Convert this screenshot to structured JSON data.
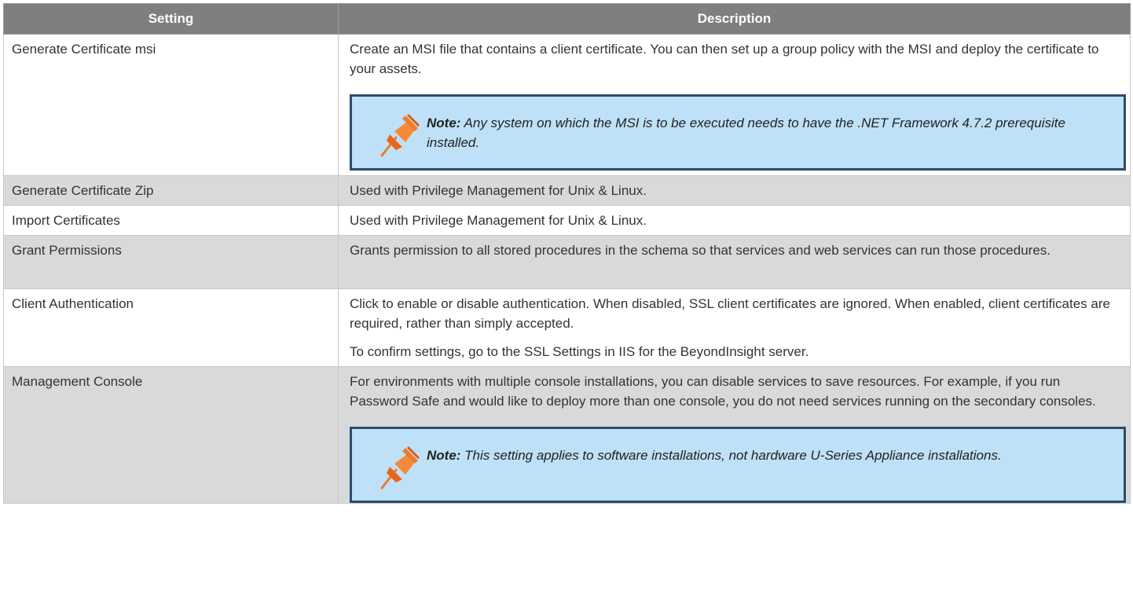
{
  "table": {
    "headers": [
      "Setting",
      "Description"
    ],
    "rows": [
      {
        "setting": "Generate Certificate msi",
        "paragraphs": [
          "Create an MSI file that contains a client certificate. You can then set up a group policy with the MSI and deploy the certificate to your assets."
        ],
        "note": {
          "label": "Note:",
          "text": " Any system on which the MSI is to be executed needs to have the .NET Framework 4.7.2 prerequisite installed."
        }
      },
      {
        "setting": "Generate Certificate Zip",
        "paragraphs": [
          "Used with Privilege Management for Unix & Linux."
        ]
      },
      {
        "setting": "Import Certificates",
        "paragraphs": [
          "Used with Privilege Management for Unix & Linux."
        ]
      },
      {
        "setting": "Grant Permissions",
        "paragraphs": [
          "Grants permission to all stored procedures in the schema so that services and web services can run those procedures."
        ]
      },
      {
        "setting": "Client Authentication",
        "paragraphs": [
          "Click to enable or disable authentication. When disabled, SSL client certificates are ignored. When enabled, client certificates are required, rather than simply accepted.",
          "To confirm settings, go to the SSL Settings in IIS for the BeyondInsight server."
        ]
      },
      {
        "setting": "Management Console",
        "paragraphs": [
          "For environments with multiple console installations, you can disable services to save resources. For example, if you run Password Safe and would like to deploy more than one console, you do not need services running on the secondary consoles."
        ],
        "note": {
          "label": "Note:",
          "text": " This setting applies to software installations, not hardware U-Series Appliance installations."
        }
      }
    ]
  },
  "icons": {
    "note": "pushpin-icon"
  },
  "colors": {
    "header_bg": "#7f7f7f",
    "row_shade": "#d8dada",
    "note_bg": "#bfe1f7",
    "note_border": "#2a4c6d",
    "pin": "#f07a28"
  }
}
